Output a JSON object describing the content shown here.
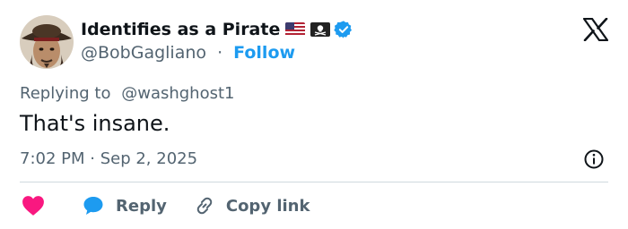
{
  "author": {
    "display_name": "Identifies as a Pirate",
    "handle": "@BobGagliano",
    "separator": "·",
    "follow_label": "Follow",
    "flags": [
      "us-flag-icon",
      "jolly-roger-flag-icon"
    ],
    "verified_icon": "verified-badge-icon"
  },
  "reply_context": {
    "prefix": "Replying to",
    "mention": "@washghost1"
  },
  "tweet": {
    "text": "That's insane.",
    "timestamp": "7:02 PM · Sep 2, 2025"
  },
  "actions": {
    "like_icon": "heart-icon",
    "reply_label": "Reply",
    "reply_icon": "speech-bubble-icon",
    "copy_link_label": "Copy link",
    "copy_link_icon": "link-icon"
  },
  "colors": {
    "accent": "#1d9bf0",
    "like": "#f91880",
    "text": "#0f1419",
    "secondary": "#536471",
    "divider": "#cfd9de"
  }
}
